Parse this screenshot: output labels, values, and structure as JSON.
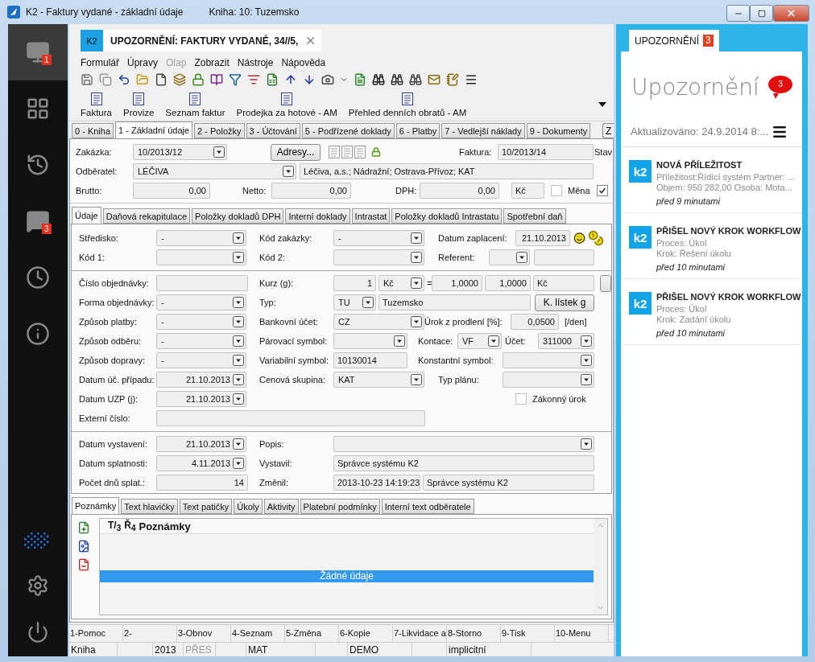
{
  "window": {
    "title": "K2 - Faktury vydané - základní údaje",
    "book": "Kniha: 10: Tuzemsko"
  },
  "sidebar": {
    "items": [
      {
        "kind": "monitor",
        "selected": true,
        "badge": "1"
      },
      {
        "kind": "apps",
        "selected": false
      },
      {
        "kind": "history",
        "selected": false
      },
      {
        "kind": "chat",
        "selected": false,
        "badge": "3"
      },
      {
        "kind": "clock",
        "selected": false
      },
      {
        "kind": "info",
        "selected": false
      }
    ]
  },
  "document_tab": {
    "logo": "K2",
    "title": "UPOZORNĚNÍ: FAKTURY VYDANÉ, 34//5,"
  },
  "menu": [
    {
      "label": "Formulář",
      "disabled": false
    },
    {
      "label": "Úpravy",
      "disabled": false
    },
    {
      "label": "Olap",
      "disabled": true
    },
    {
      "label": "Zobrazit",
      "disabled": false
    },
    {
      "label": "Nástroje",
      "disabled": false
    },
    {
      "label": "Nápověda",
      "disabled": false
    }
  ],
  "reports": [
    "Faktura",
    "Provize",
    "Seznam faktur",
    "Prodejka za hotové - AM",
    "Přehled denních obratů - AM"
  ],
  "tabs": [
    {
      "label": "0 - Kniha",
      "selected": false
    },
    {
      "label": "1 - Základní údaje",
      "selected": true
    },
    {
      "label": "2 - Položky",
      "selected": false
    },
    {
      "label": "3 - Účtování",
      "selected": false
    },
    {
      "label": "5 - Podřízené doklady",
      "selected": false
    },
    {
      "label": "6 - Platby",
      "selected": false
    },
    {
      "label": "7 - Vedlejší náklady",
      "selected": false
    },
    {
      "label": "9 - Dokumenty",
      "selected": false
    }
  ],
  "tabs_cut_button": "Z",
  "header_form": {
    "rows": [
      {
        "items": [
          {
            "kind": "label",
            "text": "Zakázka:"
          },
          {
            "kind": "combo",
            "value": "10/2013/12"
          },
          {
            "kind": "button",
            "label": "Adresy..."
          },
          {
            "kind": "label",
            "text": "Faktura:"
          },
          {
            "kind": "field",
            "value": "10/2013/14"
          },
          {
            "kind": "label",
            "text": "Stav"
          }
        ]
      },
      {
        "items": [
          {
            "kind": "label",
            "text": "Odběratel:"
          },
          {
            "kind": "combo",
            "value": "LÉČIVA"
          },
          {
            "kind": "field",
            "value": "Léčiva, a.s.; Nádražní; Ostrava-Přívoz; KAT"
          }
        ]
      },
      {
        "items": [
          {
            "kind": "label",
            "text": "Brutto:"
          },
          {
            "kind": "field",
            "value": "0,00"
          },
          {
            "kind": "label",
            "text": "Netto:"
          },
          {
            "kind": "field",
            "value": "0,00"
          },
          {
            "kind": "label",
            "text": "DPH:"
          },
          {
            "kind": "field",
            "value": "0,00"
          },
          {
            "kind": "field",
            "value": "Kč"
          },
          {
            "kind": "checkbox",
            "label": "Měna",
            "checked": false
          },
          {
            "kind": "checkbox",
            "checked": true
          }
        ]
      }
    ]
  },
  "detail_tabs": [
    {
      "label": "Údaje",
      "selected": true
    },
    {
      "label": "Daňová rekapitulace",
      "selected": false
    },
    {
      "label": "Položky dokladů DPH",
      "selected": false
    },
    {
      "label": "Interní doklady",
      "selected": false
    },
    {
      "label": "Intrastat",
      "selected": false
    },
    {
      "label": "Položky dokladů Intrastatu",
      "selected": false
    },
    {
      "label": "Spotřební daň",
      "selected": false
    }
  ],
  "sections": [
    {
      "rows": [
        {
          "items": [
            {
              "kind": "label",
              "text": "Středisko:"
            },
            {
              "kind": "combo",
              "value": "-"
            },
            {
              "kind": "label",
              "text": "Kód zakázky:"
            },
            {
              "kind": "combo",
              "value": "-"
            },
            {
              "kind": "label",
              "text": "Datum zaplacení:"
            },
            {
              "kind": "field",
              "value": "21.10.2013"
            }
          ]
        },
        {
          "items": [
            {
              "kind": "label",
              "text": "Kód 1:"
            },
            {
              "kind": "combo"
            },
            {
              "kind": "label",
              "text": "Kód 2:"
            },
            {
              "kind": "combo"
            },
            {
              "kind": "label",
              "text": "Referent:"
            },
            {
              "kind": "combo"
            },
            {
              "kind": "field"
            }
          ]
        }
      ]
    },
    {
      "rows": [
        {
          "items": [
            {
              "kind": "label",
              "text": "Číslo objednávky:"
            },
            {
              "kind": "field"
            },
            {
              "kind": "label",
              "text": "Kurz (g):"
            },
            {
              "kind": "field",
              "value": "1"
            },
            {
              "kind": "combo",
              "value": "Kč"
            },
            {
              "kind": "label",
              "text": "="
            },
            {
              "kind": "field",
              "value": "1,0000"
            },
            {
              "kind": "field",
              "value": "1,0000"
            },
            {
              "kind": "field",
              "value": "Kč"
            },
            {
              "kind": "button"
            }
          ]
        },
        {
          "items": [
            {
              "kind": "label",
              "text": "Forma objednávky:"
            },
            {
              "kind": "combo",
              "value": "-"
            },
            {
              "kind": "label",
              "text": "Typ:"
            },
            {
              "kind": "combo",
              "value": "TU"
            },
            {
              "kind": "field",
              "value": "Tuzemsko"
            },
            {
              "kind": "button",
              "label": "K. lístek g"
            }
          ]
        },
        {
          "items": [
            {
              "kind": "label",
              "text": "Způsob platby:"
            },
            {
              "kind": "combo",
              "value": "-"
            },
            {
              "kind": "label",
              "text": "Bankovní účet:"
            },
            {
              "kind": "combo",
              "value": "CZ"
            },
            {
              "kind": "label",
              "text": "Úrok z prodlení [%]:"
            },
            {
              "kind": "field",
              "value": "0,0500"
            },
            {
              "kind": "label",
              "text": "[/den]"
            }
          ]
        },
        {
          "items": [
            {
              "kind": "label",
              "text": "Způsob odběru:"
            },
            {
              "kind": "combo",
              "value": "-"
            },
            {
              "kind": "label",
              "text": "Párovací symbol:"
            },
            {
              "kind": "combo"
            },
            {
              "kind": "label",
              "text": "Kontace:"
            },
            {
              "kind": "combo",
              "value": "VF"
            },
            {
              "kind": "label",
              "text": "Účet:"
            },
            {
              "kind": "combo",
              "value": "311000"
            }
          ]
        },
        {
          "items": [
            {
              "kind": "label",
              "text": "Způsob dopravy:"
            },
            {
              "kind": "combo",
              "value": "-"
            },
            {
              "kind": "label",
              "text": "Variabilní symbol:"
            },
            {
              "kind": "field",
              "value": "10130014"
            },
            {
              "kind": "label",
              "text": "Konstantní symbol:"
            },
            {
              "kind": "combo"
            }
          ]
        },
        {
          "items": [
            {
              "kind": "label",
              "text": "Datum úč. případu:"
            },
            {
              "kind": "combo",
              "value": "21.10.2013"
            },
            {
              "kind": "label",
              "text": "Cenová skupina:"
            },
            {
              "kind": "combo",
              "value": "KAT"
            },
            {
              "kind": "label",
              "text": "Typ plánu:"
            },
            {
              "kind": "combo"
            }
          ]
        },
        {
          "items": [
            {
              "kind": "label",
              "text": "Datum UZP (j):"
            },
            {
              "kind": "combo",
              "value": "21.10.2013"
            },
            {
              "kind": "checkbox",
              "label": "Zákonný úrok",
              "checked": false
            }
          ]
        },
        {
          "items": [
            {
              "kind": "label",
              "text": "Externí číslo:"
            },
            {
              "kind": "field"
            }
          ]
        }
      ]
    },
    {
      "rows": [
        {
          "items": [
            {
              "kind": "label",
              "text": "Datum vystavení:"
            },
            {
              "kind": "combo",
              "value": "21.10.2013"
            },
            {
              "kind": "label",
              "text": "Popis:"
            },
            {
              "kind": "combo"
            }
          ]
        },
        {
          "items": [
            {
              "kind": "label",
              "text": "Datum splatnosti:"
            },
            {
              "kind": "combo",
              "value": "4.11.2013"
            },
            {
              "kind": "label",
              "text": "Vystavil:"
            },
            {
              "kind": "field",
              "value": "Správce systému K2"
            }
          ]
        },
        {
          "items": [
            {
              "kind": "label",
              "text": "Počet dnů splat.:"
            },
            {
              "kind": "field",
              "value": "14"
            },
            {
              "kind": "label",
              "text": "Změnil:"
            },
            {
              "kind": "field",
              "value": "2013-10-23 14:19:23"
            },
            {
              "kind": "field",
              "value": "Správce systému K2"
            }
          ]
        }
      ]
    }
  ],
  "notes_tabs": [
    {
      "label": "Poznámky",
      "selected": true
    },
    {
      "label": "Text hlavičky",
      "selected": false
    },
    {
      "label": "Text patičky",
      "selected": false
    },
    {
      "label": "Úkoly",
      "selected": false
    },
    {
      "label": "Aktivity",
      "selected": false
    },
    {
      "label": "Platební podmínky",
      "selected": false
    },
    {
      "label": "Interní text odběratele",
      "selected": false
    }
  ],
  "notes_grid": {
    "columns": [
      "T/$_{3}$",
      "Ř$_{4}$",
      "Poznámky"
    ],
    "empty_text": "Žádné údaje"
  },
  "function_keys": [
    "1-Pomoc",
    "2-",
    "3-Obnov",
    "4-Seznam",
    "5-Změna",
    "6-Kopie",
    "7-Likvidace a",
    "8-Storno",
    "9-Tisk",
    "10-Menu"
  ],
  "status_bar": [
    {
      "text": "Kniha",
      "disabled": false
    },
    {
      "text": "2013",
      "disabled": false
    },
    {
      "text": "PŘES",
      "disabled": true
    },
    {
      "text": "MAT",
      "disabled": false
    },
    {
      "text": "DEMO",
      "disabled": false
    },
    {
      "text": "implicitní",
      "disabled": false
    }
  ],
  "notifications": {
    "tab": "UPOZORNĚNÍ",
    "tab_badge": "3",
    "heading": "Upozornění",
    "bubble": "3",
    "updated": "Aktualizováno: 24.9.2014 8:...",
    "items": [
      {
        "logo": "k2",
        "title": "NOVÁ PŘÍLEŽITOST",
        "lines": [
          "Příležitost:Řídicí systém Partner: ...",
          "Objem: 950 282,00 Osoba: Mota..."
        ],
        "time": "před 9 minutami"
      },
      {
        "logo": "k2",
        "title": "PŘIŠEL NOVÝ KROK WORKFLOW",
        "lines": [
          "Proces: Úkol",
          "Krok: Řešení úkolu"
        ],
        "time": "před 10 minutami"
      },
      {
        "logo": "k2",
        "title": "PŘIŠEL NOVÝ KROK WORKFLOW",
        "lines": [
          "Proces: Úkol",
          "Krok: Zadání úkolu"
        ],
        "time": "před 10 minutami"
      }
    ]
  }
}
